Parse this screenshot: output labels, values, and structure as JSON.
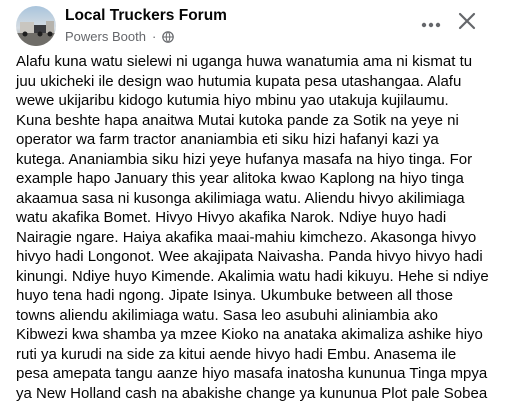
{
  "header": {
    "group_name": "Local Truckers Forum",
    "author": "Powers Booth",
    "dot": "·"
  },
  "icons": {
    "more": "more-horizontal-icon",
    "close": "close-icon",
    "privacy": "globe-icon"
  },
  "post": {
    "lines": [
      "Alafu kuna watu sielewi ni uganga huwa wanatumia ama ni kismat tu",
      "juu ukicheki ile design wao hutumia kupata pesa utashangaa. Alafu",
      "wewe ukijaribu kidogo kutumia hiyo mbinu yao utakuja kujilaumu.",
      "Kuna beshte hapa anaitwa Mutai kutoka pande za Sotik na yeye ni",
      "operator wa farm tractor ananiambia eti siku hizi hafanyi kazi ya",
      "kutega. Ananiambia siku hizi yeye hufanya masafa na hiyo tinga. For",
      "example hapo January this year alitoka kwao Kaplong na hiyo tinga",
      "akaamua sasa ni kusonga akilimiaga watu. Aliendu hivyo akilimiaga",
      "watu akafika Bomet. Hivyo Hivyo akafika Narok. Ndiye huyo hadi",
      "Nairagie ngare. Haiya akafika maai-mahiu kimchezo. Akasonga hivyo",
      "hivyo hadi Longonot. Wee akajipata Naivasha. Panda hivyo hivyo hadi",
      "kinungi. Ndiye huyo Kimende. Akalimia watu hadi kikuyu. Hehe si ndiye",
      "huyo tena hadi ngong. Jipate Isinya. Ukumbuke between all those",
      "towns aliendu akilimiaga watu. Sasa leo asubuhi aliniambia ako",
      "Kibwezi kwa shamba ya mzee Kioko na anataka akimaliza ashike hiyo",
      "ruti ya kurudi na side za kitui aende hivyo hadi Embu. Anasema ile",
      "pesa amepata tangu aanze hiyo masafa inatosha kununua Tinga mpya",
      "ya New Holland cash na abakishe change ya kununua Plot pale Sobea"
    ]
  }
}
